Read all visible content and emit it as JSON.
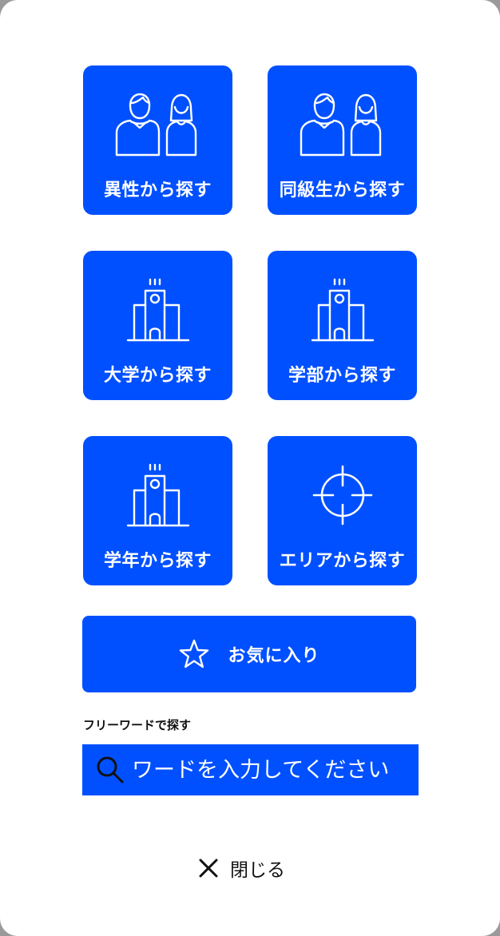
{
  "tiles": [
    {
      "label": "異性から探す",
      "icon": "couple-icon"
    },
    {
      "label": "同級生から探す",
      "icon": "couple-icon"
    },
    {
      "label": "大学から探す",
      "icon": "building-icon"
    },
    {
      "label": "学部から探す",
      "icon": "building-icon"
    },
    {
      "label": "学年から探す",
      "icon": "building-icon"
    },
    {
      "label": "エリアから探す",
      "icon": "crosshair-icon"
    }
  ],
  "favorites": {
    "label": "お気に入り",
    "icon": "star-icon"
  },
  "search": {
    "section_label": "フリーワードで探す",
    "placeholder": "ワードを入力してください",
    "value": "",
    "icon": "search-icon"
  },
  "close": {
    "label": "閉じる",
    "icon": "close-icon"
  },
  "colors": {
    "accent": "#0050ff",
    "background": "#ffffff",
    "text": "#111111"
  }
}
